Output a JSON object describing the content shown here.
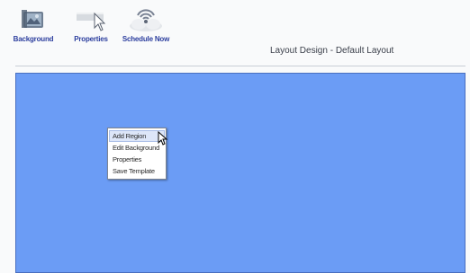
{
  "toolbar": {
    "items": [
      {
        "label": "Background",
        "icon": "background-icon"
      },
      {
        "label": "Properties",
        "icon": "properties-icon"
      },
      {
        "label": "Schedule Now",
        "icon": "schedule-now-icon"
      }
    ]
  },
  "page": {
    "title": "Layout Design - Default Layout"
  },
  "canvas": {
    "background_color": "#6b9cf5"
  },
  "context_menu": {
    "items": [
      {
        "label": "Add Region",
        "highlighted": true
      },
      {
        "label": "Edit Background",
        "highlighted": false
      },
      {
        "label": "Properties",
        "highlighted": false
      },
      {
        "label": "Save Template",
        "highlighted": false
      }
    ]
  }
}
